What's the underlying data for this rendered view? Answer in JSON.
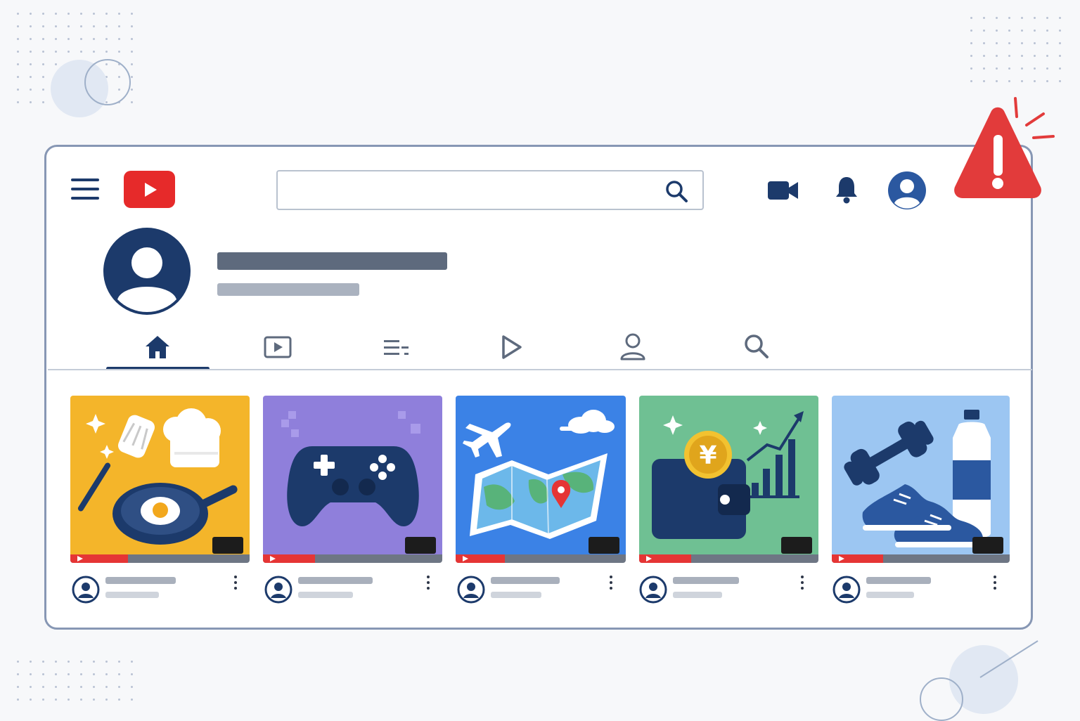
{
  "header": {
    "search": {
      "placeholder": "",
      "value": ""
    },
    "icons": [
      "menu-icon",
      "logo-play-icon",
      "search-icon",
      "video-camera-icon",
      "bell-icon",
      "account-avatar-icon"
    ]
  },
  "alert": {
    "icon": "warning-triangle-icon",
    "symbol": "!"
  },
  "channel": {
    "tabs": [
      "home-icon",
      "videos-icon",
      "playlists-icon",
      "shorts-play-icon",
      "about-person-icon",
      "channel-search-icon"
    ],
    "active_tab": 0
  },
  "videos": [
    {
      "theme": "cooking",
      "bg": "#f4b52a",
      "progress": 0.32
    },
    {
      "theme": "gaming",
      "bg": "#8f7fdb",
      "progress": 0.29
    },
    {
      "theme": "travel",
      "bg": "#3b82e6",
      "progress": 0.29
    },
    {
      "theme": "finance",
      "bg": "#6fc093",
      "progress": 0.29
    },
    {
      "theme": "fitness",
      "bg": "#9cc6f2",
      "progress": 0.29
    }
  ],
  "colors": {
    "primary": "#1c3a6b",
    "accent_red": "#e62a2a",
    "border": "#8797b4"
  },
  "labels": {
    "currency_symbol": "¥"
  }
}
